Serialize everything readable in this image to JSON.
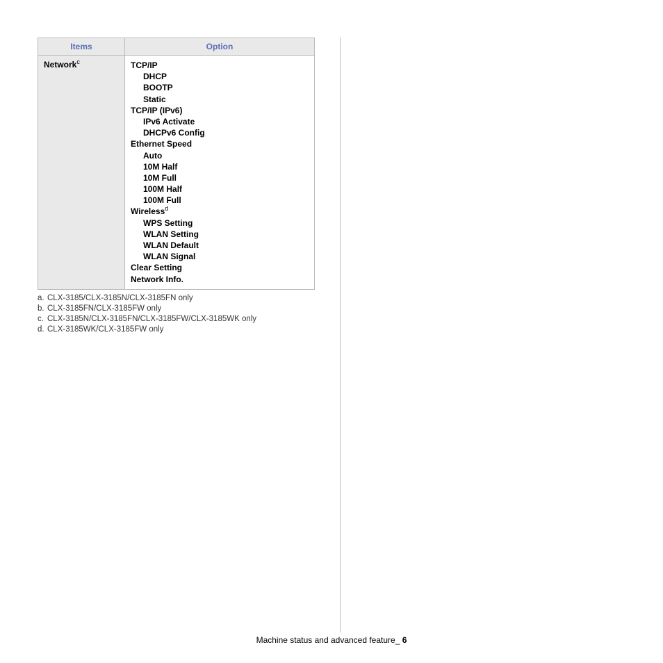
{
  "table": {
    "headers": {
      "items": "Items",
      "option": "Option"
    },
    "row": {
      "item": "Network",
      "item_sup": "c",
      "options": [
        {
          "text": "TCP/IP",
          "level": 0
        },
        {
          "text": "DHCP",
          "level": 1
        },
        {
          "text": "BOOTP",
          "level": 1
        },
        {
          "text": "Static",
          "level": 1
        },
        {
          "text": "TCP/IP (IPv6)",
          "level": 0
        },
        {
          "text": "IPv6 Activate",
          "level": 1
        },
        {
          "text": "DHCPv6 Config",
          "level": 1
        },
        {
          "text": "Ethernet Speed",
          "level": 0
        },
        {
          "text": "Auto",
          "level": 1
        },
        {
          "text": "10M Half",
          "level": 1
        },
        {
          "text": "10M Full",
          "level": 1
        },
        {
          "text": "100M Half",
          "level": 1
        },
        {
          "text": "100M Full",
          "level": 1
        },
        {
          "text": "Wireless",
          "level": 0,
          "sup": "d"
        },
        {
          "text": "WPS Setting",
          "level": 1
        },
        {
          "text": "WLAN Setting",
          "level": 1
        },
        {
          "text": "WLAN Default",
          "level": 1
        },
        {
          "text": "WLAN Signal",
          "level": 1
        },
        {
          "text": "Clear Setting",
          "level": 0
        },
        {
          "text": "Network Info.",
          "level": 0
        }
      ]
    }
  },
  "footnotes": {
    "a": "CLX-3185/CLX-3185N/CLX-3185FN only",
    "b": "CLX-3185FN/CLX-3185FW only",
    "c": "CLX-3185N/CLX-3185FN/CLX-3185FW/CLX-3185WK only",
    "d": "CLX-3185WK/CLX-3185FW only"
  },
  "footer": {
    "text": "Machine status and advanced feature",
    "sep": "_ ",
    "page": "6"
  }
}
